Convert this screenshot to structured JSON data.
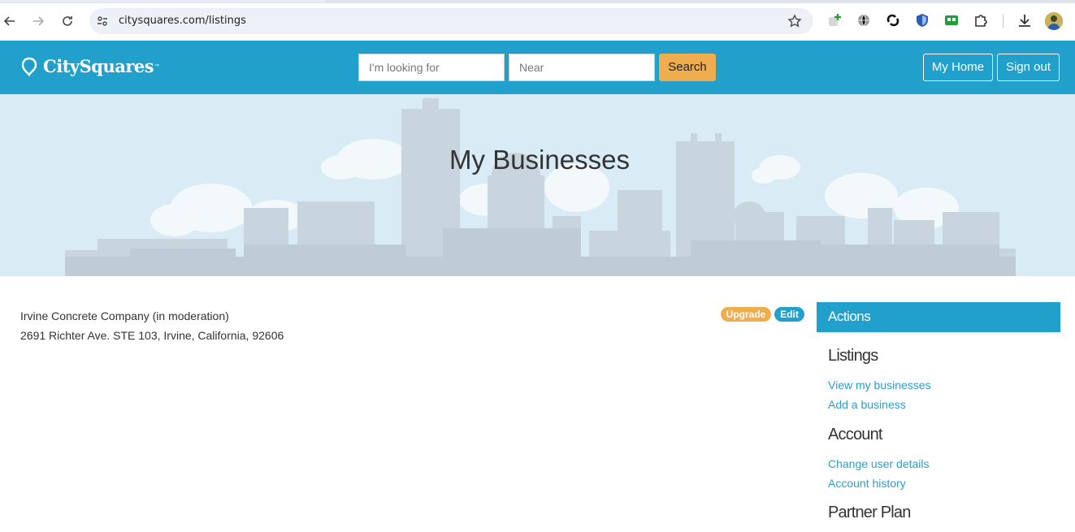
{
  "browser": {
    "url": "citysquares.com/listings"
  },
  "header": {
    "logo_text": "CitySquares",
    "logo_tm": "™",
    "search_placeholder": "I'm looking for",
    "near_placeholder": "Near",
    "search_label": "Search",
    "my_home_label": "My Home",
    "sign_out_label": "Sign out"
  },
  "hero": {
    "title": "My Businesses"
  },
  "business": {
    "name": "Irvine Concrete Company (in moderation)",
    "address": "2691 Richter Ave. STE 103, Irvine, California, 92606",
    "upgrade_label": "Upgrade",
    "edit_label": "Edit"
  },
  "sidebar": {
    "header": "Actions",
    "sections": [
      {
        "title": "Listings",
        "links": [
          "View my businesses",
          "Add a business"
        ]
      },
      {
        "title": "Account",
        "links": [
          "Change user details",
          "Account history"
        ]
      },
      {
        "title": "Partner Plan",
        "links": []
      }
    ]
  },
  "colors": {
    "brand_blue": "#21a0cb",
    "accent_orange": "#f0ad4e",
    "hero_bg": "#d9ecf6"
  }
}
